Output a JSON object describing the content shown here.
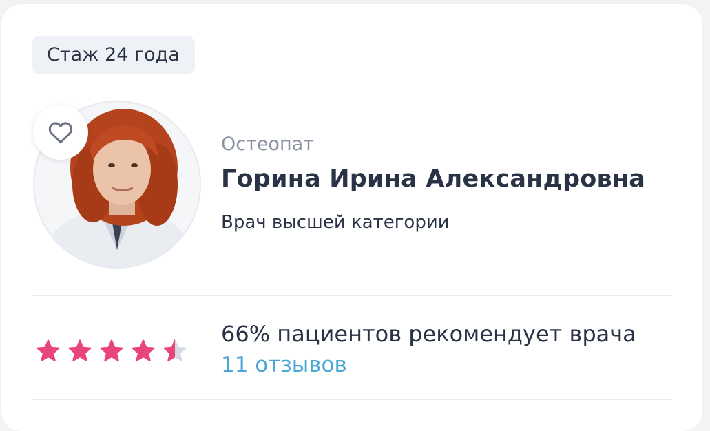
{
  "experience_badge": "Стаж 24 года",
  "doctor": {
    "specialty": "Остеопат",
    "name": "Горина Ирина Александровна",
    "category": "Врач высшей категории",
    "photo_alt": "doctor-photo"
  },
  "rating": {
    "value": 4.5,
    "max": 5,
    "recommend_text": "66% пациентов рекомендует врача",
    "reviews_link": "11 отзывов"
  },
  "colors": {
    "star_active": "#e8457a",
    "star_inactive": "#d5d9e0",
    "link": "#4aa6d6",
    "heart_stroke": "#6b7385"
  },
  "icons": {
    "favorite": "heart-outline-icon",
    "star": "star-icon"
  }
}
